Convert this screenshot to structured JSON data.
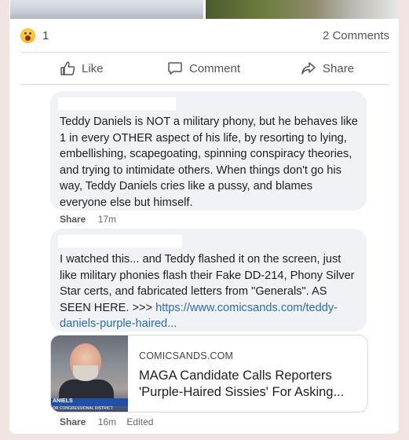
{
  "reactions": {
    "emoji": "haha-emoji-icon",
    "count": "1",
    "comments_label": "2 Comments"
  },
  "actions": {
    "like": "Like",
    "comment": "Comment",
    "share": "Share"
  },
  "comments": [
    {
      "text": "Teddy Daniels is NOT a military phony, but he behaves like 1 in every OTHER aspect of his life, by resorting to lying, embellishing, scapegoating, spinning conspiracy theories, and trying to intimidate others. When things don't go his way, Teddy Daniels cries like a pussy, and blames everyone else but himself.",
      "share_label": "Share",
      "time": "17m"
    },
    {
      "text": "I watched this... and Teddy flashed it on the screen, just like military phonies flash their Fake DD-214, Phony Silver Star certs, and fabricated letters from \"Generals\". AS SEEN HERE. >>> ",
      "link": "https://www.comicsands.com/teddy-daniels-purple-haired...",
      "share_label": "Share",
      "time": "16m",
      "edited": "Edited"
    }
  ],
  "link_preview": {
    "domain": "COMICSANDS.COM",
    "title": "MAGA Candidate Calls Reporters 'Purple-Haired Sissies' For Asking...",
    "thumb_bar": "ANIELS",
    "thumb_sub": "OR CONGRESSIONAL DISTRICT"
  }
}
